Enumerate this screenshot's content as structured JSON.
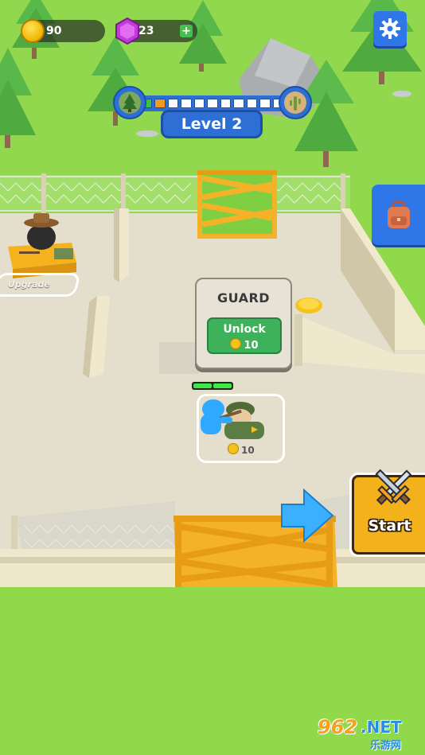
{
  "hud": {
    "coins": "90",
    "gems": "23",
    "plus_label": "+",
    "level_label": "Level 2",
    "level_progress": {
      "filled_segments": 2,
      "total_segments": 11,
      "current_segment": 2
    },
    "level_start_icon": "tree-icon",
    "level_end_icon": "cactus-icon"
  },
  "buttons": {
    "settings_icon": "gear-icon",
    "backpack_icon": "backpack-icon",
    "start_label": "Start",
    "start_icon": "crossed-swords-icon"
  },
  "guard_card": {
    "title": "GUARD",
    "unlock_label": "Unlock",
    "unlock_cost": "10"
  },
  "slot": {
    "cost": "10",
    "health_fraction": 1.0
  },
  "upgrade": {
    "label": "Upgrade"
  },
  "watermark": {
    "brand": "962",
    "suffix": ".NET",
    "sub": "乐游网"
  },
  "colors": {
    "grass": "#8fd94a",
    "floor": "#e3dfcc",
    "wall": "#efe8cc",
    "gate": "#f4b228",
    "accent_blue": "#2f76e8",
    "unlock_green": "#3eb25a",
    "start_yellow": "#f3b21c"
  }
}
